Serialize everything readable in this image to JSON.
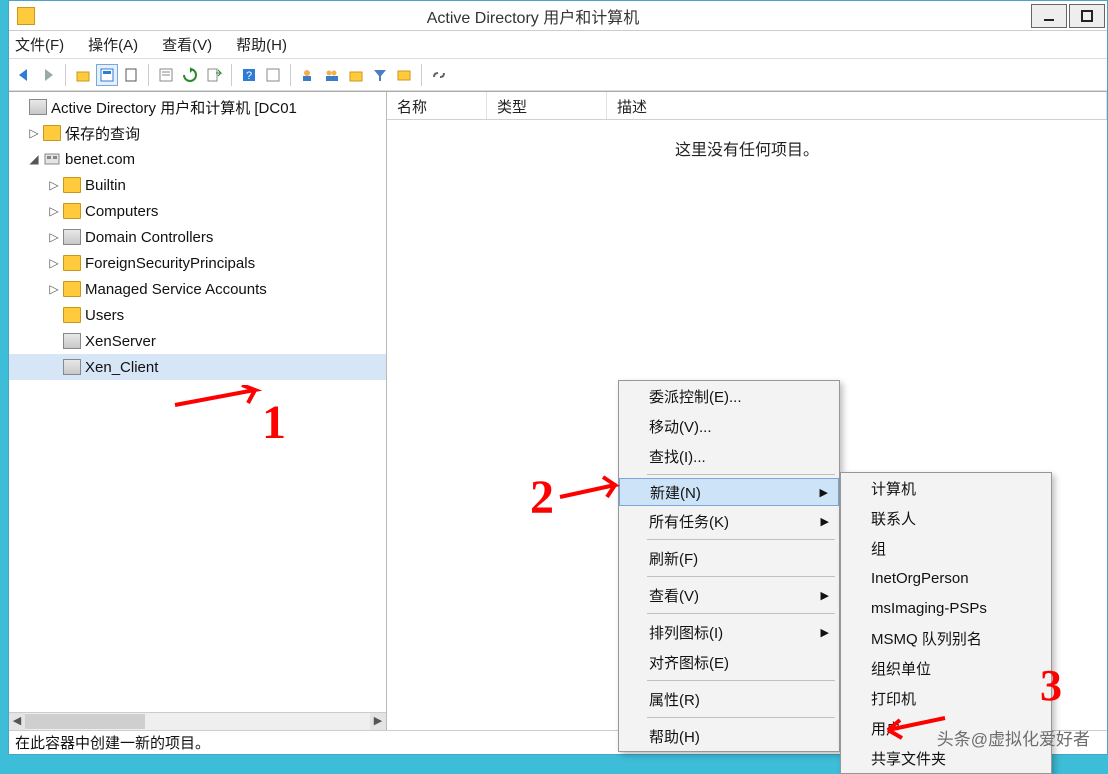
{
  "window": {
    "title": "Active Directory 用户和计算机",
    "app_icon": "folder-icon"
  },
  "menubar": {
    "file": "文件(F)",
    "action": "操作(A)",
    "view": "查看(V)",
    "help": "帮助(H)"
  },
  "toolbar": {
    "icons": [
      "back-icon",
      "forward-icon",
      "sep",
      "up-icon",
      "show-icon",
      "cut-icon",
      "sep",
      "properties-icon",
      "refresh-icon",
      "export-icon",
      "sep",
      "help-icon",
      "options-icon",
      "sep",
      "user-add-icon",
      "user-group-icon",
      "folder-add-icon",
      "filter-icon",
      "find-icon",
      "sep",
      "link-icon"
    ]
  },
  "tree": {
    "root": {
      "label": "Active Directory 用户和计算机 [DC01",
      "icon": "org-icon"
    },
    "saved_queries": {
      "label": "保存的查询",
      "icon": "folder-icon",
      "exp": "▷"
    },
    "domain": {
      "label": "benet.com",
      "icon": "domain-icon",
      "exp": "◢"
    },
    "children": [
      {
        "label": "Builtin",
        "icon": "folder-icon",
        "exp": "▷"
      },
      {
        "label": "Computers",
        "icon": "folder-icon",
        "exp": "▷"
      },
      {
        "label": "Domain Controllers",
        "icon": "org-icon",
        "exp": "▷"
      },
      {
        "label": "ForeignSecurityPrincipals",
        "icon": "folder-icon",
        "exp": "▷"
      },
      {
        "label": "Managed Service Accounts",
        "icon": "folder-icon",
        "exp": "▷"
      },
      {
        "label": "Users",
        "icon": "folder-icon",
        "exp": ""
      },
      {
        "label": "XenServer",
        "icon": "org-icon",
        "exp": ""
      },
      {
        "label": "Xen_Client",
        "icon": "org-icon",
        "exp": "",
        "selected": true
      }
    ]
  },
  "list": {
    "columns": {
      "name": "名称",
      "type": "类型",
      "desc": "描述"
    },
    "empty": "这里没有任何项目。"
  },
  "context_menu": {
    "items1": [
      {
        "label": "委派控制(E)..."
      },
      {
        "label": "移动(V)..."
      },
      {
        "label": "查找(I)..."
      }
    ],
    "new_item": {
      "label": "新建(N)",
      "submenu": true,
      "highlight": true
    },
    "all_tasks": {
      "label": "所有任务(K)",
      "submenu": true
    },
    "refresh": {
      "label": "刷新(F)"
    },
    "view": {
      "label": "查看(V)",
      "submenu": true
    },
    "arrange": {
      "label": "排列图标(I)",
      "submenu": true
    },
    "align": {
      "label": "对齐图标(E)"
    },
    "properties": {
      "label": "属性(R)"
    },
    "help": {
      "label": "帮助(H)"
    }
  },
  "submenu": {
    "items": [
      "计算机",
      "联系人",
      "组",
      "InetOrgPerson",
      "msImaging-PSPs",
      "MSMQ 队列别名",
      "组织单位",
      "打印机",
      "用户",
      "共享文件夹"
    ]
  },
  "statusbar": {
    "text": "在此容器中创建一新的项目。"
  },
  "annotations": {
    "a1": "1",
    "a2": "2",
    "a3": "3"
  },
  "watermark": "头条@虚拟化爱好者"
}
